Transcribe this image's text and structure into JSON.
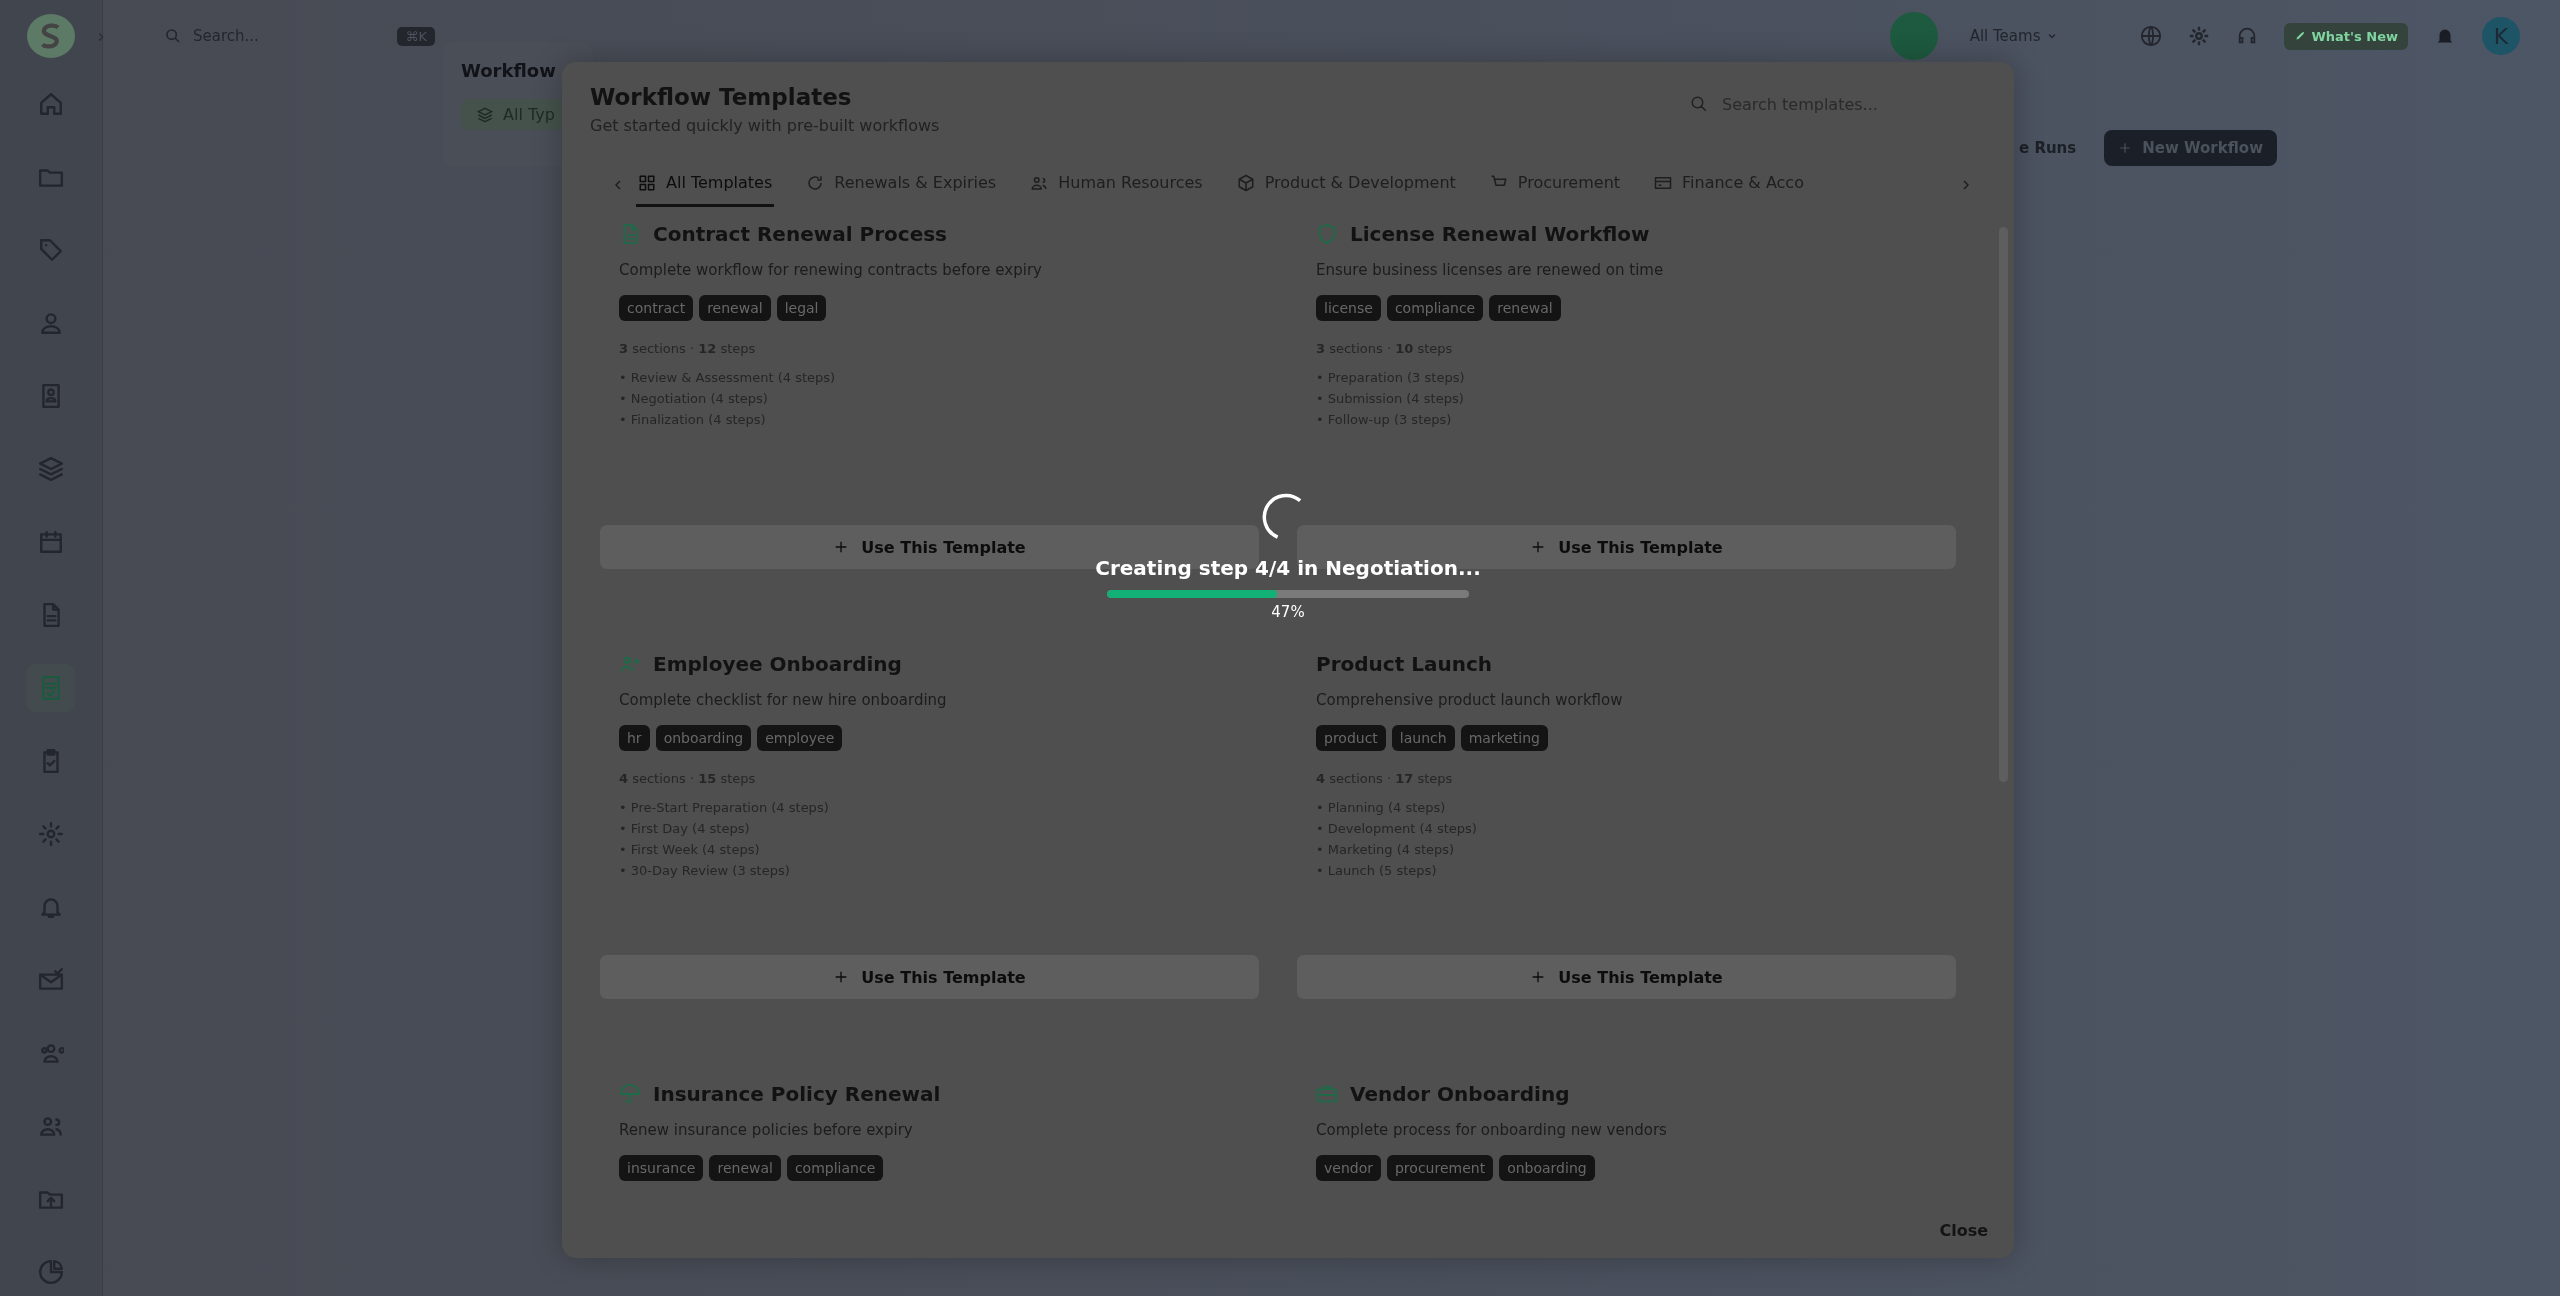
{
  "sidebar": {
    "items": [
      {
        "selected": false
      },
      {
        "selected": false
      },
      {
        "selected": false
      },
      {
        "selected": false
      },
      {
        "selected": false
      },
      {
        "selected": false
      },
      {
        "selected": false
      },
      {
        "selected": false
      },
      {
        "selected": true
      },
      {
        "selected": false
      },
      {
        "selected": false
      },
      {
        "selected": false
      },
      {
        "selected": false
      },
      {
        "selected": false
      },
      {
        "selected": false
      },
      {
        "selected": false
      },
      {
        "selected": false
      }
    ]
  },
  "topbar": {
    "search": {
      "placeholder": "Search...",
      "shortcut": "⌘K"
    },
    "team_selector": "All Teams",
    "whats_new": "What's New",
    "avatar": "K"
  },
  "background_page": {
    "title": "Workflow",
    "filter_chip": "All Typ",
    "runs_link": "e Runs",
    "new_button": "New Workflow"
  },
  "modal": {
    "title": "Workflow Templates",
    "subtitle": "Get started quickly with pre-built workflows",
    "search": {
      "placeholder": "Search templates..."
    },
    "tabs": [
      {
        "label": "All Templates",
        "selected": true
      },
      {
        "label": "Renewals & Expiries",
        "selected": false
      },
      {
        "label": "Human Resources",
        "selected": false
      },
      {
        "label": "Product & Development",
        "selected": false
      },
      {
        "label": "Procurement",
        "selected": false
      },
      {
        "label": "Finance & Acco",
        "selected": false
      }
    ],
    "templates": [
      {
        "kind": "document",
        "title": "Contract Renewal Process",
        "description": "Complete workflow for renewing contracts before expiry",
        "tags": [
          "contract",
          "renewal",
          "legal"
        ],
        "summary": "**3** sections · **12** steps",
        "sections": [
          "• Review & Assessment (4 steps)",
          "• Negotiation (4 steps)",
          "• Finalization (4 steps)"
        ],
        "button": "Use This Template"
      },
      {
        "kind": "shield",
        "title": "License Renewal Workflow",
        "description": "Ensure business licenses are renewed on time",
        "tags": [
          "license",
          "compliance",
          "renewal"
        ],
        "summary": "**3** sections · **10** steps",
        "sections": [
          "• Preparation (3 steps)",
          "• Submission (4 steps)",
          "• Follow-up (3 steps)"
        ],
        "button": "Use This Template"
      },
      {
        "kind": "user-plus",
        "title": "Employee Onboarding",
        "description": "Complete checklist for new hire onboarding",
        "tags": [
          "hr",
          "onboarding",
          "employee"
        ],
        "summary": "**4** sections · **15** steps",
        "sections": [
          "• Pre-Start Preparation (4 steps)",
          "• First Day (4 steps)",
          "• First Week (4 steps)",
          "• 30-Day Review (3 steps)"
        ],
        "button": "Use This Template"
      },
      {
        "kind": "hidden",
        "title": "Product Launch",
        "description": "Comprehensive product launch workflow",
        "tags": [
          "product",
          "launch",
          "marketing"
        ],
        "summary": "**4** sections · **17** steps",
        "sections": [
          "• Planning (4 steps)",
          "• Development (4 steps)",
          "• Marketing (4 steps)",
          "• Launch (5 steps)"
        ],
        "button": "Use This Template"
      },
      {
        "kind": "umbrella",
        "title": "Insurance Policy Renewal",
        "description": "Renew insurance policies before expiry",
        "tags": [
          "insurance",
          "renewal",
          "compliance"
        ]
      },
      {
        "kind": "briefcase",
        "title": "Vendor Onboarding",
        "description": "Complete process for onboarding new vendors",
        "tags": [
          "vendor",
          "procurement",
          "onboarding"
        ]
      }
    ],
    "close_button": "Close",
    "loading": {
      "message": "Creating step 4/4 in Negotiation...",
      "level": 0.47,
      "percent": "47%"
    }
  }
}
